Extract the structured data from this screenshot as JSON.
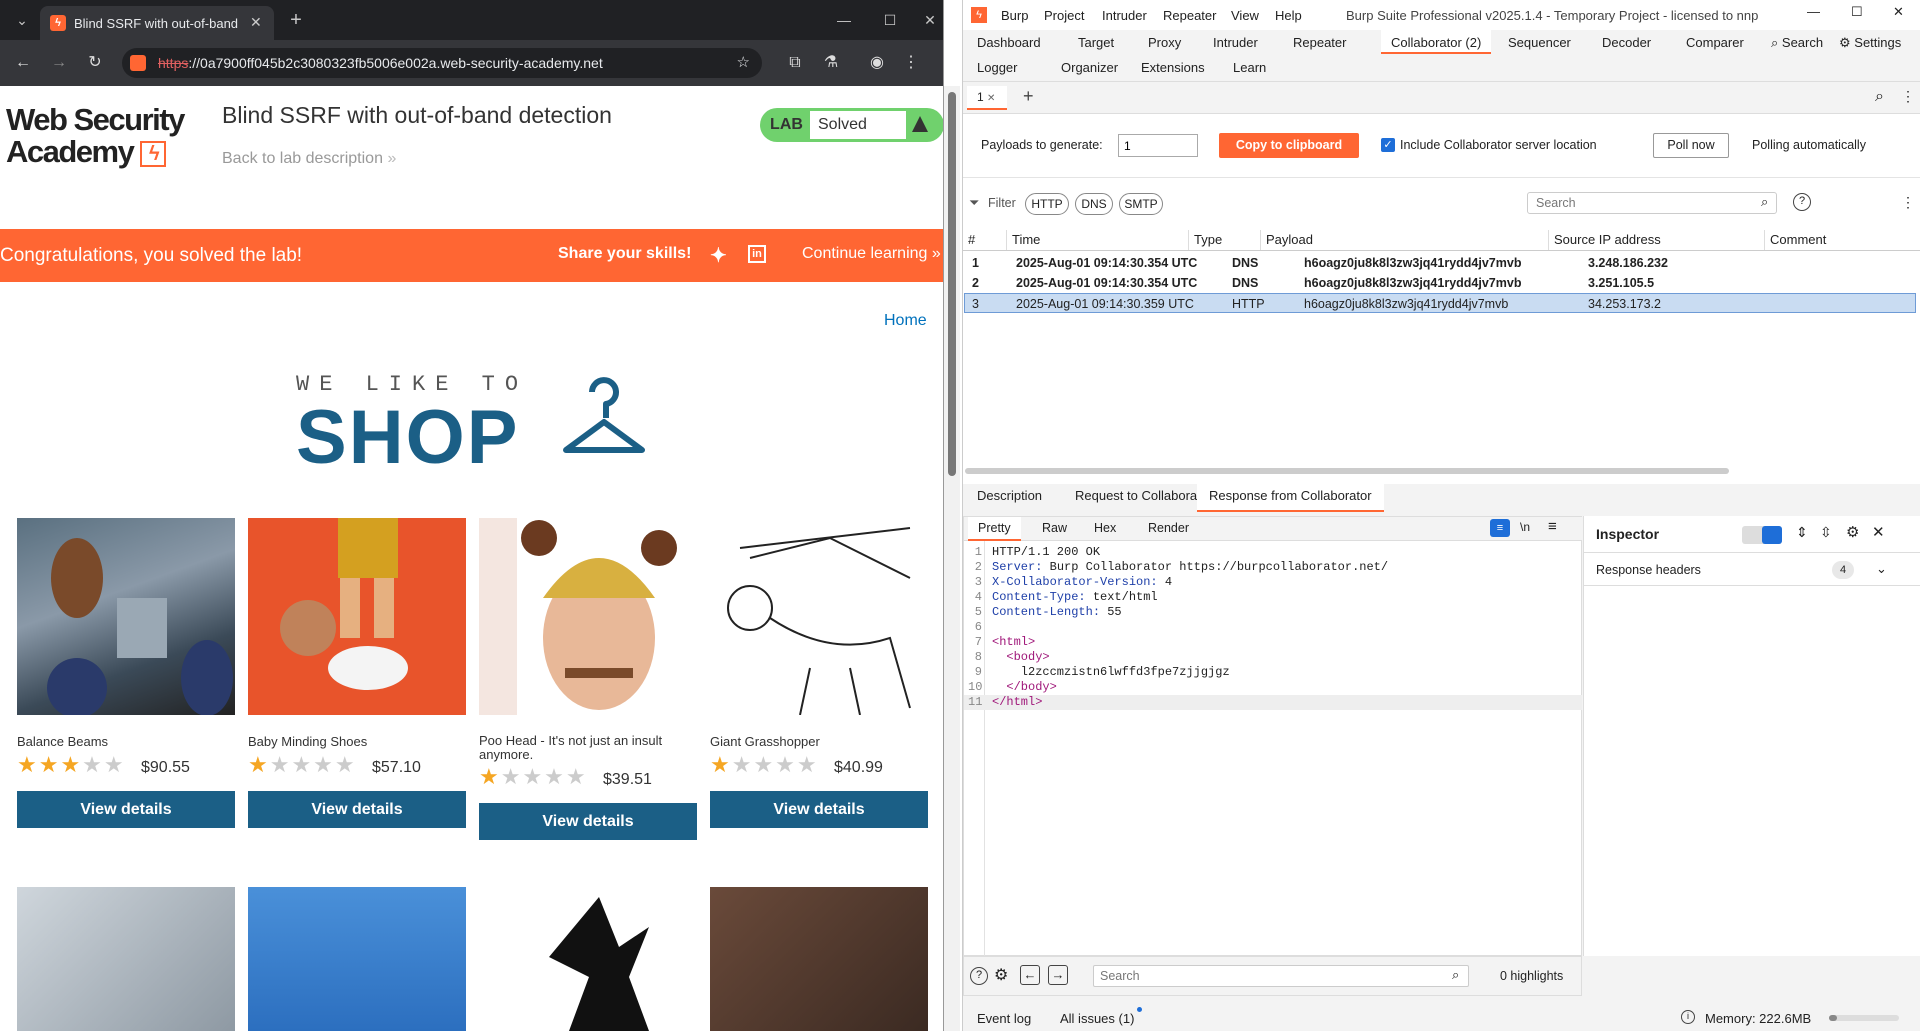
{
  "browser": {
    "tab_title": "Blind SSRF with out-of-band de",
    "url_scheme": "https",
    "url_rest": "://0a7900ff045b2c3080323fb5006e002a.web-security-academy.net"
  },
  "lab": {
    "logo_line1": "Web Security",
    "logo_line2": "Academy",
    "title": "Blind SSRF with out-of-band detection",
    "back_link": "Back to lab description",
    "badge_lab": "LAB",
    "badge_status": "Solved",
    "banner_congrats": "Congratulations, you solved the lab!",
    "banner_share": "Share your skills!",
    "banner_continue": "Continue learning",
    "home_link": "Home",
    "shop_small": "WE LIKE TO",
    "shop_big": "SHOP"
  },
  "products": [
    {
      "name": "Balance Beams",
      "price": "$90.55",
      "rating": 3,
      "button": "View details"
    },
    {
      "name": "Baby Minding Shoes",
      "price": "$57.10",
      "rating": 1,
      "button": "View details"
    },
    {
      "name": "Poo Head - It's not just an insult anymore.",
      "price": "$39.51",
      "rating": 1,
      "button": "View details"
    },
    {
      "name": "Giant Grasshopper",
      "price": "$40.99",
      "rating": 1,
      "button": "View details"
    }
  ],
  "burp": {
    "menu": [
      "Burp",
      "Project",
      "Intruder",
      "Repeater",
      "View",
      "Help"
    ],
    "title": "Burp Suite Professional v2025.1.4 - Temporary Project - licensed to nnp",
    "tabs_row1": [
      "Dashboard",
      "Target",
      "Proxy",
      "Intruder",
      "Repeater",
      "Collaborator (2)",
      "Sequencer",
      "Decoder",
      "Comparer"
    ],
    "search_label": "Search",
    "settings_label": "Settings",
    "tabs_row2": [
      "Logger",
      "Organizer",
      "Extensions",
      "Learn"
    ],
    "subtab": "1",
    "payloads_label": "Payloads to generate:",
    "payloads_value": "1",
    "copy_button": "Copy to clipboard",
    "include_label": "Include Collaborator server location",
    "poll_button": "Poll now",
    "polling_label": "Polling automatically",
    "filter_label": "Filter",
    "filter_pills": [
      "HTTP",
      "DNS",
      "SMTP"
    ],
    "search_placeholder": "Search",
    "columns": [
      "#",
      "Time",
      "Type",
      "Payload",
      "Source IP address",
      "Comment"
    ],
    "rows": [
      {
        "num": "1",
        "time": "2025-Aug-01 09:14:30.354 UTC",
        "type": "DNS",
        "payload": "h6oagz0ju8k8l3zw3jq41rydd4jv7mvb",
        "ip": "3.248.186.232"
      },
      {
        "num": "2",
        "time": "2025-Aug-01 09:14:30.354 UTC",
        "type": "DNS",
        "payload": "h6oagz0ju8k8l3zw3jq41rydd4jv7mvb",
        "ip": "3.251.105.5"
      },
      {
        "num": "3",
        "time": "2025-Aug-01 09:14:30.359 UTC",
        "type": "HTTP",
        "payload": "h6oagz0ju8k8l3zw3jq41rydd4jv7mvb",
        "ip": "34.253.173.2"
      }
    ],
    "detail_tabs": [
      "Description",
      "Request to Collaborator",
      "Response from Collaborator"
    ],
    "view_tabs": [
      "Pretty",
      "Raw",
      "Hex",
      "Render"
    ],
    "response_lines": [
      "HTTP/1.1 200 OK",
      "Server: Burp Collaborator https://burpcollaborator.net/",
      "X-Collaborator-Version: 4",
      "Content-Type: text/html",
      "Content-Length: 55",
      "",
      "<html>",
      "  <body>",
      "    l2zccmzistn6lwffd3fpe7zjjgjgz",
      "  </body>",
      "</html>"
    ],
    "inspector_title": "Inspector",
    "inspector_section": "Response headers",
    "inspector_count": "4",
    "editor_search_placeholder": "Search",
    "highlights": "0 highlights",
    "status_event_log": "Event log",
    "status_issues": "All issues (1)",
    "status_memory": "Memory: 222.6MB"
  }
}
